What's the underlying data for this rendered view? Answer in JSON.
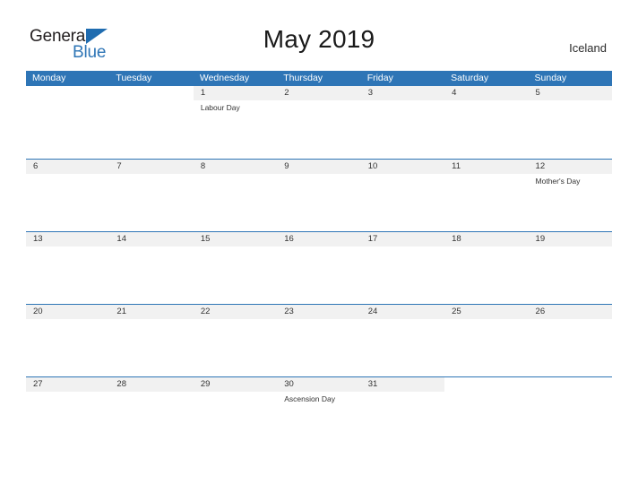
{
  "brand": {
    "name_part1": "General",
    "name_part2": "Blue"
  },
  "header": {
    "title": "May 2019",
    "country": "Iceland"
  },
  "colors": {
    "header_blue": "#2E75B6",
    "band_gray": "#F1F1F1",
    "text_dark": "#333333"
  },
  "calendar": {
    "weekdays": [
      "Monday",
      "Tuesday",
      "Wednesday",
      "Thursday",
      "Friday",
      "Saturday",
      "Sunday"
    ],
    "weeks": [
      {
        "days": [
          {
            "num": "",
            "event": ""
          },
          {
            "num": "",
            "event": ""
          },
          {
            "num": "1",
            "event": "Labour Day"
          },
          {
            "num": "2",
            "event": ""
          },
          {
            "num": "3",
            "event": ""
          },
          {
            "num": "4",
            "event": ""
          },
          {
            "num": "5",
            "event": ""
          }
        ]
      },
      {
        "days": [
          {
            "num": "6",
            "event": ""
          },
          {
            "num": "7",
            "event": ""
          },
          {
            "num": "8",
            "event": ""
          },
          {
            "num": "9",
            "event": ""
          },
          {
            "num": "10",
            "event": ""
          },
          {
            "num": "11",
            "event": ""
          },
          {
            "num": "12",
            "event": "Mother's Day"
          }
        ]
      },
      {
        "days": [
          {
            "num": "13",
            "event": ""
          },
          {
            "num": "14",
            "event": ""
          },
          {
            "num": "15",
            "event": ""
          },
          {
            "num": "16",
            "event": ""
          },
          {
            "num": "17",
            "event": ""
          },
          {
            "num": "18",
            "event": ""
          },
          {
            "num": "19",
            "event": ""
          }
        ]
      },
      {
        "days": [
          {
            "num": "20",
            "event": ""
          },
          {
            "num": "21",
            "event": ""
          },
          {
            "num": "22",
            "event": ""
          },
          {
            "num": "23",
            "event": ""
          },
          {
            "num": "24",
            "event": ""
          },
          {
            "num": "25",
            "event": ""
          },
          {
            "num": "26",
            "event": ""
          }
        ]
      },
      {
        "days": [
          {
            "num": "27",
            "event": ""
          },
          {
            "num": "28",
            "event": ""
          },
          {
            "num": "29",
            "event": ""
          },
          {
            "num": "30",
            "event": "Ascension Day"
          },
          {
            "num": "31",
            "event": ""
          },
          {
            "num": "",
            "event": ""
          },
          {
            "num": "",
            "event": ""
          }
        ]
      }
    ]
  }
}
